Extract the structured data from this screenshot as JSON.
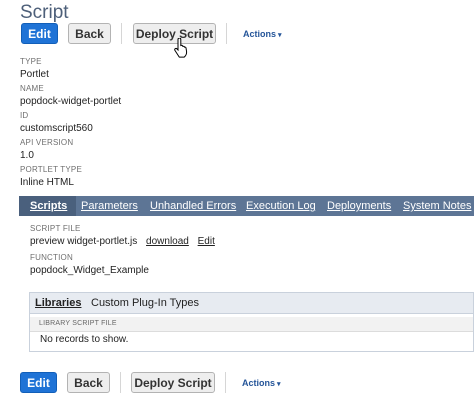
{
  "page": {
    "title": "Script"
  },
  "toolbar": {
    "edit_label": "Edit",
    "back_label": "Back",
    "deploy_label": "Deploy Script",
    "actions_label": "Actions",
    "actions_caret": "▾"
  },
  "fields": [
    {
      "label": "TYPE",
      "value": "Portlet"
    },
    {
      "label": "NAME",
      "value": "popdock-widget-portlet"
    },
    {
      "label": "ID",
      "value": "customscript560"
    },
    {
      "label": "API VERSION",
      "value": "1.0"
    },
    {
      "label": "PORTLET TYPE",
      "value": "Inline HTML"
    }
  ],
  "tabs": [
    {
      "label": "Scripts",
      "active": true
    },
    {
      "label": "Parameters"
    },
    {
      "label": "Unhandled Errors"
    },
    {
      "label": "Execution Log"
    },
    {
      "label": "Deployments"
    },
    {
      "label": "System Notes"
    }
  ],
  "scripts_tab": {
    "script_file_label": "SCRIPT FILE",
    "script_file_name": "preview widget-portlet.js",
    "download_label": "download",
    "edit_label": "Edit",
    "function_label": "FUNCTION",
    "function_value": "popdock_Widget_Example"
  },
  "library": {
    "tabs": [
      {
        "label": "Libraries",
        "active": true
      },
      {
        "label": "Custom Plug-In Types"
      }
    ],
    "column_header": "LIBRARY SCRIPT FILE",
    "empty_message": "No records to show."
  },
  "colors": {
    "primary_button": "#1f73d6",
    "tabbar": "#5d7595",
    "title": "#4d5f79"
  }
}
